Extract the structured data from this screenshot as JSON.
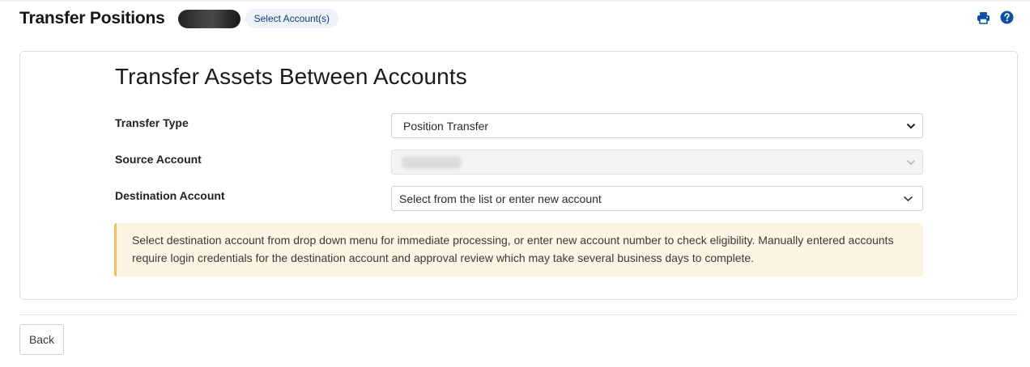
{
  "header": {
    "title": "Transfer Positions",
    "select_accounts_label": "Select Account(s)",
    "icons": [
      "print-icon",
      "help-icon"
    ]
  },
  "form": {
    "title": "Transfer Assets Between Accounts",
    "transfer_type": {
      "label": "Transfer Type",
      "value": "Position Transfer"
    },
    "source_account": {
      "label": "Source Account",
      "value": ""
    },
    "destination_account": {
      "label": "Destination Account",
      "placeholder": "Select from the list or enter new account"
    },
    "notice": "Select destination account from drop down menu for immediate processing, or enter new account number to check eligibility. Manually entered accounts require login credentials for the destination account and approval review which may take several business days to complete."
  },
  "footer": {
    "back_label": "Back"
  },
  "colors": {
    "brand_blue": "#0b4fa8",
    "notice_bg": "#fdf4e3",
    "notice_border": "#f0c15a"
  }
}
